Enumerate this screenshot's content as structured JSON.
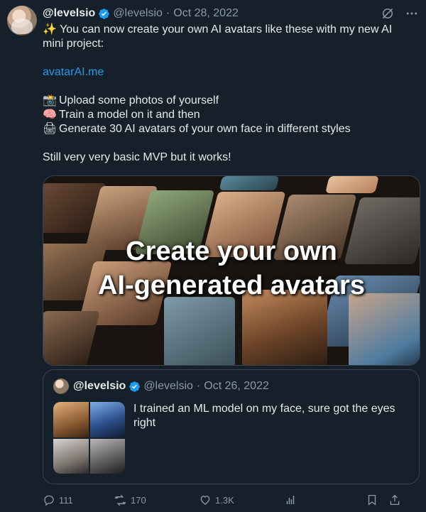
{
  "tweet": {
    "author_name": "@levelsio",
    "handle": "@levelsio",
    "separator": "·",
    "date": "Oct 28, 2022",
    "lines": [
      "You can now create your own AI avatars like these with my new AI mini project:",
      "",
      "avatarAI.me",
      "",
      "Upload some photos of yourself",
      "Train a model on it and then",
      "Generate 30 AI avatars of your own face in different styles",
      "",
      "Still very very basic MVP but it works!"
    ],
    "line1_emoji": "✨",
    "line1": "You can now create your own AI avatars like these with my new AI mini project:",
    "link": "avatarAI.me",
    "step1_emoji": "📸",
    "step1": "Upload some photos of yourself",
    "step2_emoji": "🧠",
    "step2": "Train a model on it and then",
    "step3_emoji": "🖨",
    "step3": "Generate 30 AI avatars of your own face in different styles",
    "closing": "Still very very basic MVP but it works!",
    "media_overlay_line1": "Create your own",
    "media_overlay_line2": "AI-generated avatars"
  },
  "quote": {
    "author_name": "@levelsio",
    "handle": "@levelsio",
    "separator": "·",
    "date": "Oct 26, 2022",
    "text": "I trained an ML model on my face, sure got the eyes right"
  },
  "actions": {
    "replies": "111",
    "retweets": "170",
    "likes": "1.3K"
  },
  "icons": {
    "verified": "verified-badge-icon",
    "grok": "grok-icon",
    "more": "more-icon",
    "reply": "reply-icon",
    "retweet": "retweet-icon",
    "like": "heart-icon",
    "views": "views-icon",
    "bookmark": "bookmark-icon",
    "share": "share-icon"
  },
  "colors": {
    "background": "#15202b",
    "text": "#e7e9ea",
    "muted": "#8b98a5",
    "link": "#1d9bf0",
    "verified": "#1d9bf0",
    "border": "#38444d"
  }
}
